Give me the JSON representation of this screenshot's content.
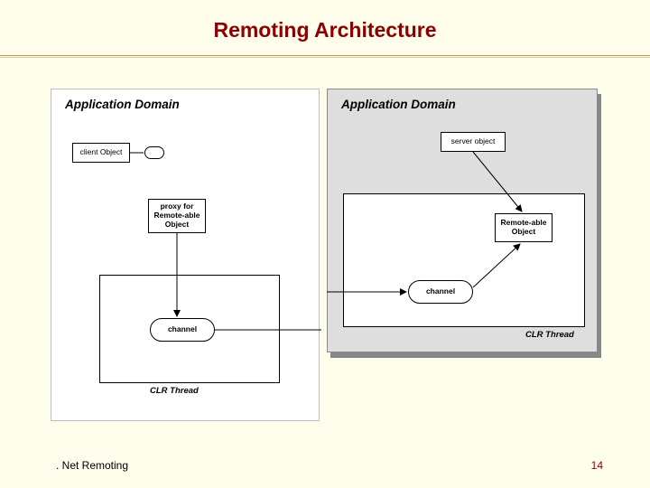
{
  "slide": {
    "title": "Remoting Architecture",
    "footer_left": ". Net Remoting",
    "page_number": "14"
  },
  "panels": {
    "left_header": "Application Domain",
    "right_header": "Application Domain"
  },
  "left": {
    "client_object": "client Object",
    "proxy": "proxy for\nRemote-able\nObject",
    "channel": "channel",
    "clr_thread": "CLR Thread"
  },
  "right": {
    "server_object": "server object",
    "remoteable_object": "Remote-able\nObject",
    "channel": "channel",
    "clr_thread": "CLR Thread"
  }
}
